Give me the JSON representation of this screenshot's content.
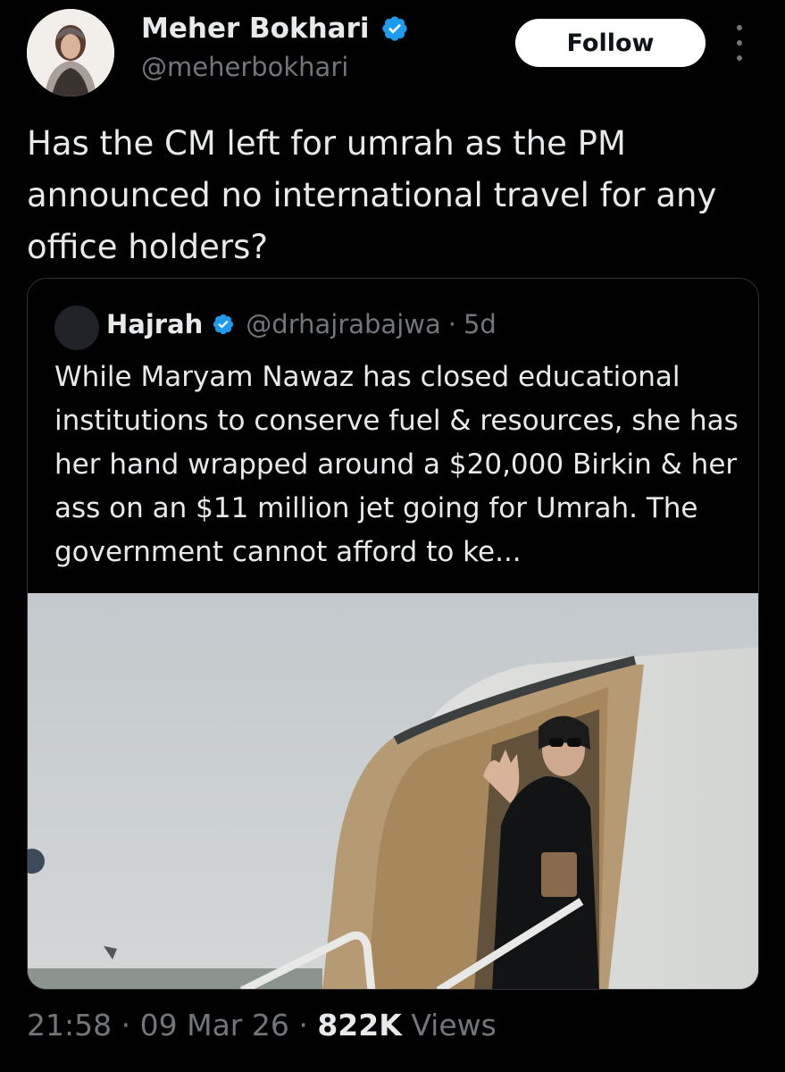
{
  "author": {
    "name": "Meher Bokhari",
    "handle": "@meherbokhari",
    "verified": true,
    "avatar_icon": "profile-photo"
  },
  "follow_label": "Follow",
  "tweet_text": "Has the CM left for umrah as the PM announced no international travel for any office holders?",
  "quote": {
    "name": "Hajrah",
    "handle": "@drhajrabajwa",
    "separator": "·",
    "age": "5d",
    "verified": true,
    "text": "While Maryam Nawaz has closed educational institutions to conserve fuel & resources, she has her hand wrapped around a $20,000 Birkin & her ass on an $11 million jet going for Umrah. The government cannot afford to ke...",
    "media_icon": "photo-woman-waving-at-jet-door"
  },
  "meta": {
    "time": "21:58",
    "sep1": "·",
    "date": "09 Mar 26",
    "sep2": "·",
    "views_count": "822K",
    "views_label": "Views"
  },
  "colors": {
    "background": "#000000",
    "text": "#e7e9ea",
    "muted": "#71767b",
    "verified": "#1d9bf0",
    "border": "#2f3336"
  }
}
